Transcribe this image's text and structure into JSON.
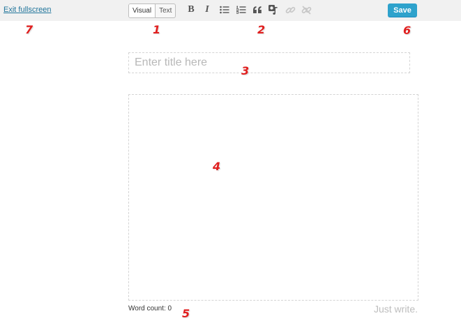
{
  "toolbar": {
    "exit_fullscreen": "Exit fullscreen",
    "mode_visual": "Visual",
    "mode_text": "Text",
    "save_label": "Save",
    "formatting_buttons": [
      "bold-icon",
      "italic-icon",
      "bullet-list-icon",
      "numbered-list-icon",
      "blockquote-icon",
      "insert-media-icon",
      "link-icon",
      "unlink-icon"
    ]
  },
  "editor": {
    "title_placeholder": "Enter title here",
    "content_value": ""
  },
  "footer": {
    "word_count": "Word count: 0",
    "tagline": "Just write."
  },
  "callouts": [
    "1",
    "2",
    "3",
    "4",
    "5",
    "6",
    "7"
  ],
  "colors": {
    "accent": "#2ea2cc",
    "link": "#21759b",
    "callout": "#e01f1f",
    "toolbar_bg": "#f1f1f1"
  }
}
